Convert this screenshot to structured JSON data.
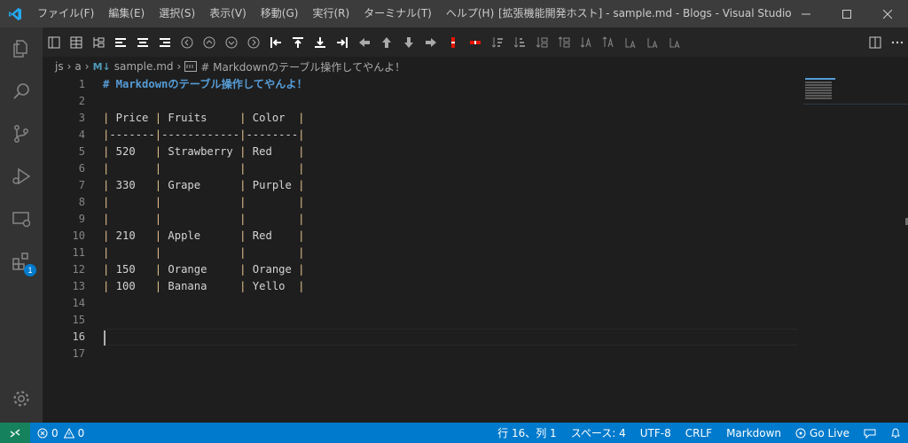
{
  "titlebar": {
    "menu": [
      "ファイル(F)",
      "編集(E)",
      "選択(S)",
      "表示(V)",
      "移動(G)",
      "実行(R)",
      "ターミナル(T)",
      "ヘルプ(H)"
    ],
    "window_title": "[拡張機能開発ホスト] - sample.md - Blogs - Visual Studio Co..."
  },
  "activitybar": {
    "extensions_badge": "1"
  },
  "breadcrumb": {
    "folder1": "js",
    "folder2": "a",
    "file_icon": "M↓",
    "file": "sample.md",
    "symbol": "# Markdownのテーブル操作してやんよ！"
  },
  "editor": {
    "line_numbers": [
      "1",
      "2",
      "3",
      "4",
      "5",
      "6",
      "7",
      "8",
      "9",
      "10",
      "11",
      "12",
      "13",
      "14",
      "15",
      "16",
      "17"
    ],
    "lines": [
      "# Markdownのテーブル操作してやんよ！",
      "",
      "| Price | Fruits     | Color  |",
      "|-------|------------|--------|",
      "| 520   | Strawberry | Red    |",
      "|       |            |        |",
      "| 330   | Grape      | Purple |",
      "|       |            |        |",
      "|       |            |        |",
      "| 210   | Apple      | Red    |",
      "|       |            |        |",
      "| 150   | Orange     | Orange |",
      "| 100   | Banana     | Yello  |",
      "",
      "",
      "",
      ""
    ],
    "active_line": "16"
  },
  "statusbar": {
    "errors": "0",
    "warnings": "0",
    "position": "行 16、列 1",
    "indent": "スペース: 4",
    "encoding": "UTF-8",
    "eol": "CRLF",
    "language": "Markdown",
    "golive": "Go Live"
  },
  "colors": {
    "accent": "#007acc",
    "heading": "#569cd6",
    "table_pipe": "#e2c08d",
    "remote": "#16825d"
  }
}
